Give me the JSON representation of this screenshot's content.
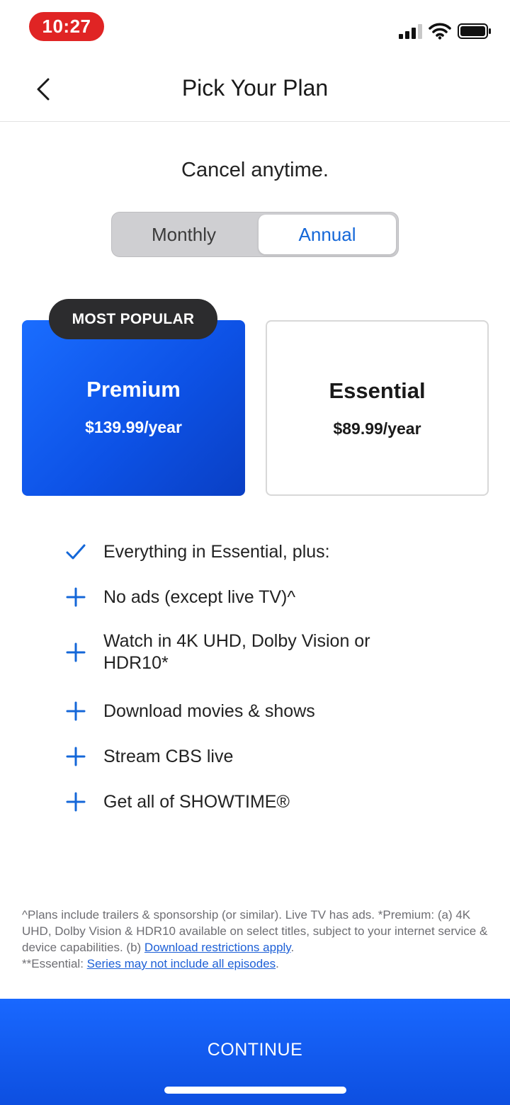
{
  "status_bar": {
    "time": "10:27"
  },
  "header": {
    "title": "Pick Your Plan"
  },
  "cancel_text": "Cancel anytime.",
  "billing_toggle": {
    "options": [
      "Monthly",
      "Annual"
    ],
    "selected": "Annual"
  },
  "plans": [
    {
      "name": "Premium",
      "price": "$139.99/year",
      "badge": "MOST POPULAR",
      "selected": true
    },
    {
      "name": "Essential",
      "price": "$89.99/year",
      "selected": false
    }
  ],
  "features": [
    {
      "icon": "check-icon",
      "text": "Everything in Essential, plus:"
    },
    {
      "icon": "plus-icon",
      "text": "No ads (except live TV)^"
    },
    {
      "icon": "plus-icon",
      "text": "Watch in 4K UHD, Dolby Vision or HDR10*"
    },
    {
      "icon": "plus-icon",
      "text": "Download movies & shows"
    },
    {
      "icon": "plus-icon",
      "text": "Stream CBS live"
    },
    {
      "icon": "plus-icon",
      "text": "Get all of SHOWTIME®"
    }
  ],
  "legal": {
    "part1": "^Plans include trailers & sponsorship (or similar). Live TV has ads. *Premium: (a) 4K UHD, Dolby Vision & HDR10 available on select titles, subject to your internet service & device capabilities. (b) ",
    "link1": "Download restrictions apply",
    "part2": ".",
    "part3": "**Essential: ",
    "link2": "Series may not include all episodes",
    "part4": "."
  },
  "continue_label": "CONTINUE",
  "colors": {
    "accent": "#1467d8",
    "brand_blue": "#0d52e6",
    "badge_dark": "#2c2c2e"
  }
}
